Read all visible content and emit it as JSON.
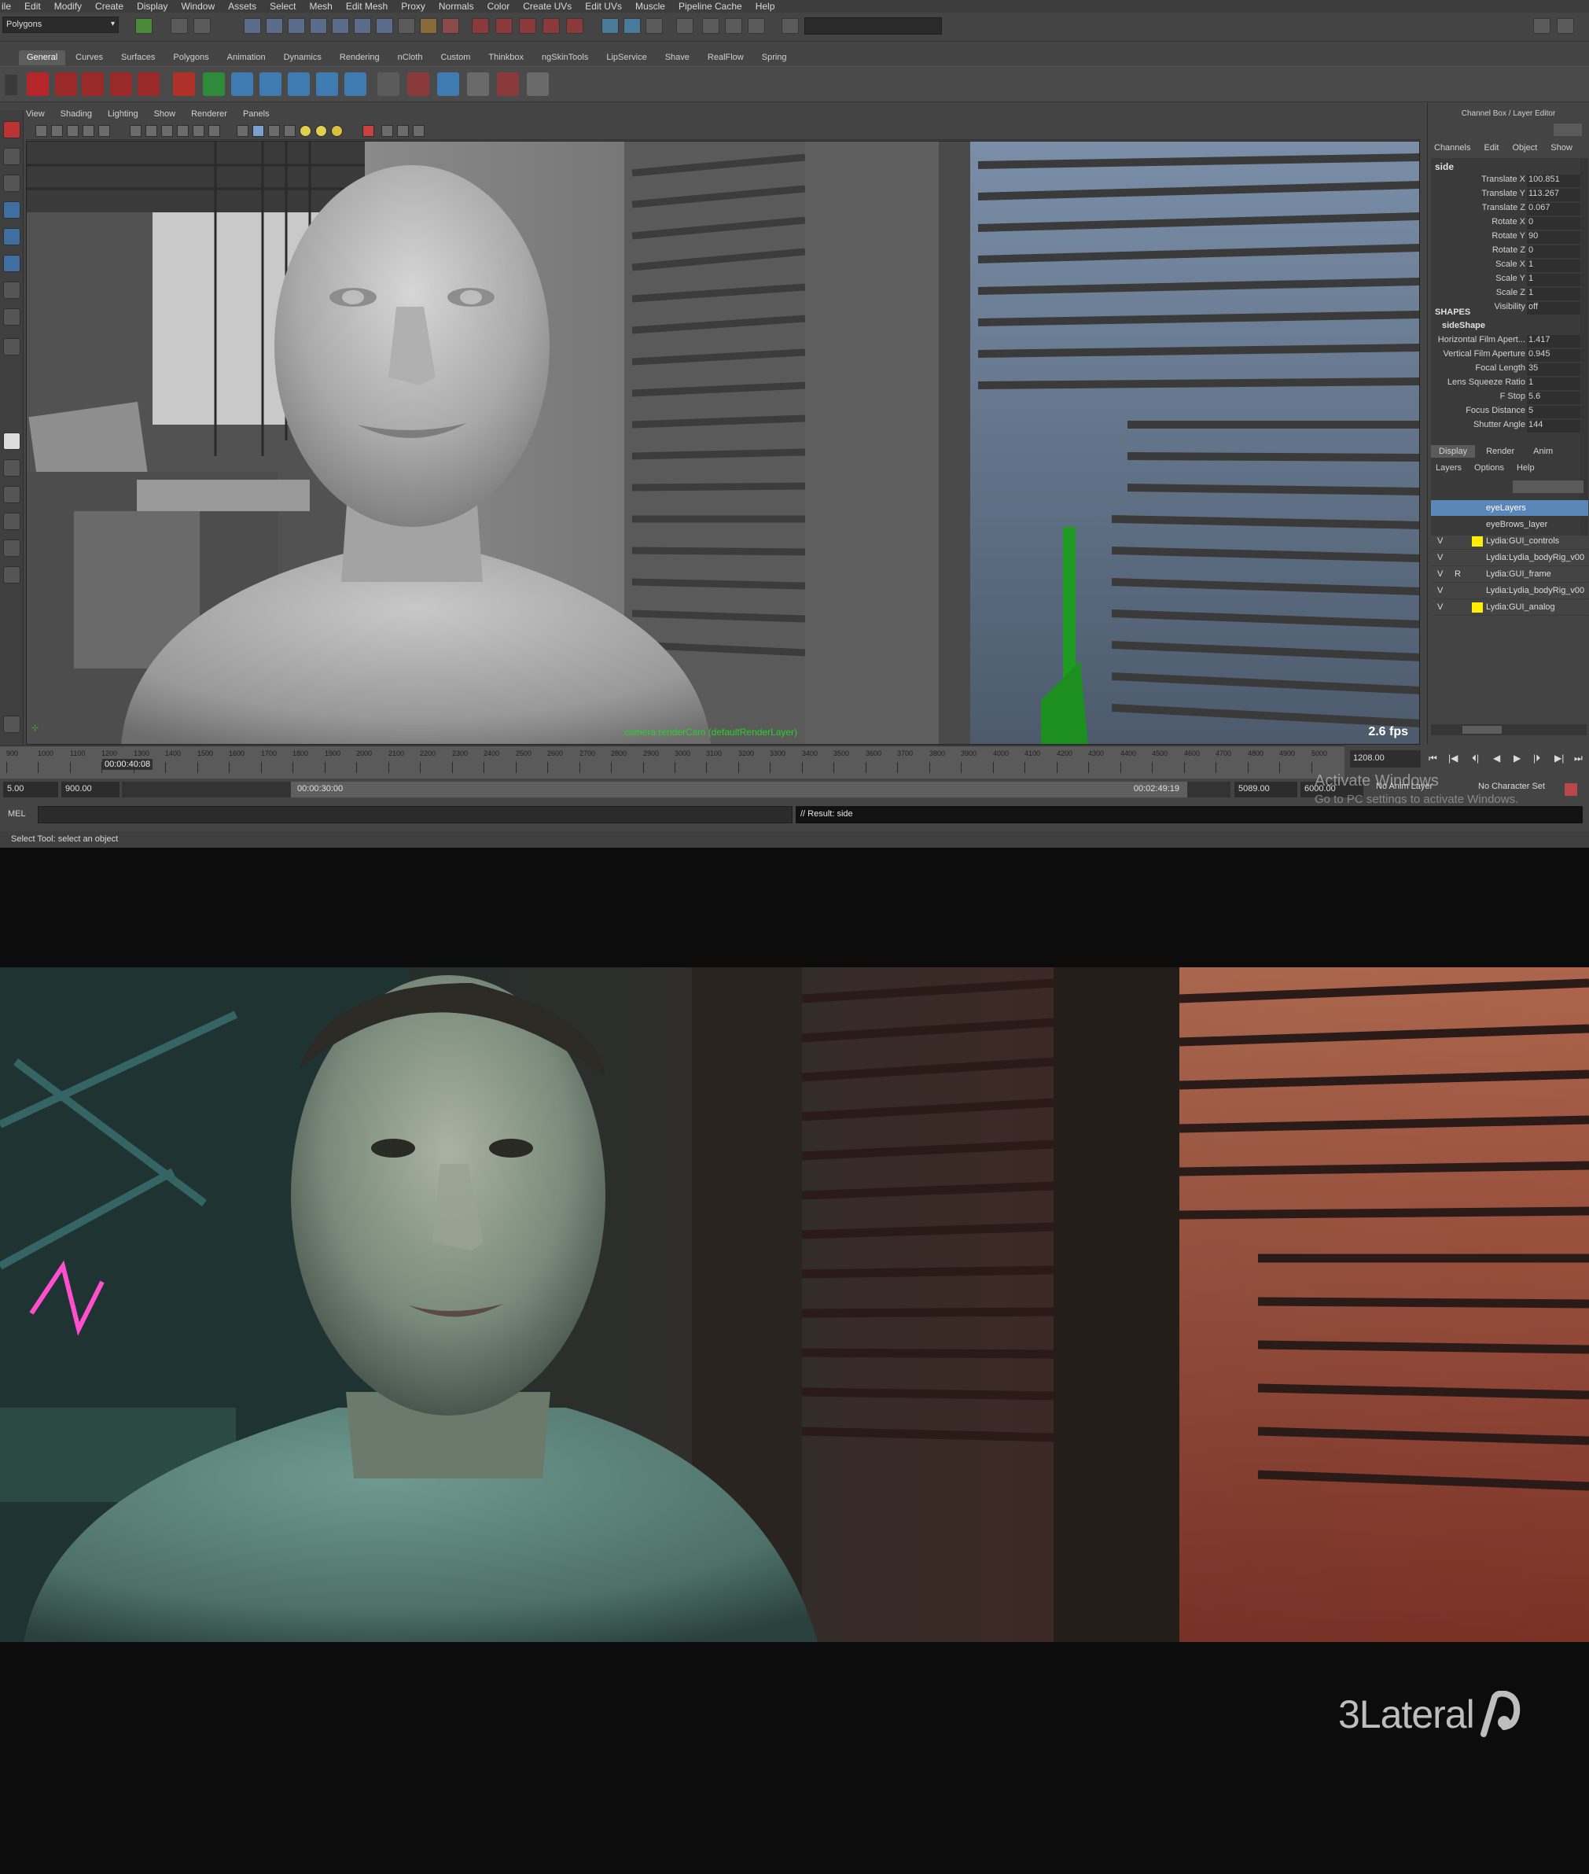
{
  "menu": [
    "ile",
    "Edit",
    "Modify",
    "Create",
    "Display",
    "Window",
    "Assets",
    "Select",
    "Mesh",
    "Edit Mesh",
    "Proxy",
    "Normals",
    "Color",
    "Create UVs",
    "Edit UVs",
    "Muscle",
    "Pipeline Cache",
    "Help"
  ],
  "status_line": {
    "mode": "Polygons"
  },
  "shelf_tabs": [
    "General",
    "Curves",
    "Surfaces",
    "Polygons",
    "Animation",
    "Dynamics",
    "Rendering",
    "nCloth",
    "Custom",
    "Thinkbox",
    "ngSkinTools",
    "LipService",
    "Shave",
    "RealFlow",
    "Spring"
  ],
  "shelf_active_tab": "General",
  "viewport_menu": [
    "View",
    "Shading",
    "Lighting",
    "Show",
    "Renderer",
    "Panels"
  ],
  "viewport": {
    "camera_label": "camera:renderCam (defaultRenderLayer)",
    "fps": "2.6 fps"
  },
  "channel_box": {
    "title": "Channel Box / Layer Editor",
    "tabs": [
      "Channels",
      "Edit",
      "Object",
      "Show"
    ],
    "object": "side",
    "attributes": [
      {
        "label": "Translate X",
        "value": "100.851"
      },
      {
        "label": "Translate Y",
        "value": "113.267"
      },
      {
        "label": "Translate Z",
        "value": "0.067"
      },
      {
        "label": "Rotate X",
        "value": "0"
      },
      {
        "label": "Rotate Y",
        "value": "90"
      },
      {
        "label": "Rotate Z",
        "value": "0"
      },
      {
        "label": "Scale X",
        "value": "1"
      },
      {
        "label": "Scale Y",
        "value": "1"
      },
      {
        "label": "Scale Z",
        "value": "1"
      },
      {
        "label": "Visibility",
        "value": "off"
      }
    ],
    "shapes_header": "SHAPES",
    "shape_name": "sideShape",
    "shape_attributes": [
      {
        "label": "Horizontal Film Apert...",
        "value": "1.417"
      },
      {
        "label": "Vertical Film Aperture",
        "value": "0.945"
      },
      {
        "label": "Focal Length",
        "value": "35"
      },
      {
        "label": "Lens Squeeze Ratio",
        "value": "1"
      },
      {
        "label": "F Stop",
        "value": "5.6"
      },
      {
        "label": "Focus Distance",
        "value": "5"
      },
      {
        "label": "Shutter Angle",
        "value": "144"
      }
    ]
  },
  "layer_editor": {
    "tabs": [
      "Display",
      "Render",
      "Anim"
    ],
    "active_tab": "Display",
    "menu": [
      "Layers",
      "Options",
      "Help"
    ],
    "layers": [
      {
        "name": "eyeLayers",
        "v": "",
        "r": "",
        "color": "",
        "selected": true
      },
      {
        "name": "eyeBrows_layer",
        "v": "",
        "r": "",
        "color": "",
        "selected": false
      },
      {
        "name": "Lydia:GUI_controls",
        "v": "V",
        "r": "",
        "color": "#ffee00",
        "selected": false
      },
      {
        "name": "Lydia:Lydia_bodyRig_v00",
        "v": "V",
        "r": "",
        "color": "",
        "selected": false
      },
      {
        "name": "Lydia:GUI_frame",
        "v": "V",
        "r": "R",
        "color": "",
        "selected": false
      },
      {
        "name": "Lydia:Lydia_bodyRig_v00",
        "v": "V",
        "r": "",
        "color": "",
        "selected": false
      },
      {
        "name": "Lydia:GUI_analog",
        "v": "V",
        "r": "",
        "color": "#ffee00",
        "selected": false
      }
    ]
  },
  "time_slider": {
    "ticks": [
      "900",
      "1000",
      "1100",
      "1200",
      "1300",
      "1400",
      "1500",
      "1600",
      "1700",
      "1800",
      "1900",
      "2000",
      "2100",
      "2200",
      "2300",
      "2400",
      "2500",
      "2600",
      "2700",
      "2800",
      "2900",
      "3000",
      "3100",
      "3200",
      "3300",
      "3400",
      "3500",
      "3600",
      "3700",
      "3800",
      "3900",
      "4000",
      "4100",
      "4200",
      "4300",
      "4400",
      "4500",
      "4600",
      "4700",
      "4800",
      "4900",
      "5000"
    ],
    "current_timecode": "00:00:40:08",
    "current_frame": "1208.00"
  },
  "range_slider": {
    "start": "5.00",
    "range_start": "900.00",
    "range_start_tc": "00:00:30:00",
    "range_end_tc": "00:02:49:19",
    "range_end": "5089.00",
    "end": "6000.00",
    "anim_layer": "No Anim Layer",
    "character_set": "No Character Set"
  },
  "command_line": {
    "label": "MEL",
    "result": "// Result: side"
  },
  "help_line": "Select Tool: select an object",
  "watermark": {
    "title": "Activate Windows",
    "subtitle": "Go to PC settings to activate Windows."
  },
  "logo": "3Lateral"
}
